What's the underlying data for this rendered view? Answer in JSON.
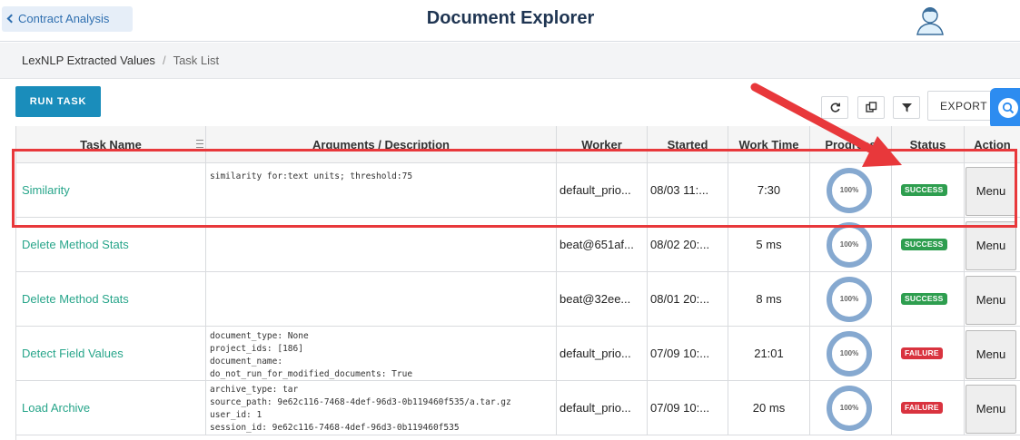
{
  "header": {
    "back_label": "Contract Analysis",
    "title": "Document Explorer"
  },
  "breadcrumb": {
    "parent": "LexNLP Extracted Values",
    "separator": "/",
    "current": "Task List"
  },
  "toolbar": {
    "run_task_label": "RUN TASK",
    "export_label": "EXPORT"
  },
  "table": {
    "columns": [
      "Task Name",
      "Arguments / Description",
      "Worker",
      "Started",
      "Work Time",
      "Progress",
      "Status",
      "Action"
    ],
    "rows": [
      {
        "name": "Similarity",
        "args": "similarity for:text units; threshold:75",
        "worker": "default_prio...",
        "started": "08/03 11:...",
        "work_time": "7:30",
        "progress_label": "100%",
        "progress": 1.0,
        "status": "SUCCESS",
        "action": "Menu"
      },
      {
        "name": "Delete Method Stats",
        "args": "",
        "worker": "beat@651af...",
        "started": "08/02 20:...",
        "work_time": "5 ms",
        "progress_label": "100%",
        "progress": 1.0,
        "status": "SUCCESS",
        "action": "Menu"
      },
      {
        "name": "Delete Method Stats",
        "args": "",
        "worker": "beat@32ee...",
        "started": "08/01 20:...",
        "work_time": "8 ms",
        "progress_label": "100%",
        "progress": 1.0,
        "status": "SUCCESS",
        "action": "Menu"
      },
      {
        "name": "Detect Field Values",
        "args": "document_type: None\nproject_ids: [186]\ndocument_name:\ndo_not_run_for_modified_documents: True",
        "worker": "default_prio...",
        "started": "07/09 10:...",
        "work_time": "21:01",
        "progress_label": "100%",
        "progress": 1.0,
        "status": "FAILURE",
        "action": "Menu"
      },
      {
        "name": "Load Archive",
        "args": "archive_type: tar\nsource_path: 9e62c116-7468-4def-96d3-0b119460f535/a.tar.gz\nuser_id: 1\nsession_id: 9e62c116-7468-4def-96d3-0b119460f535",
        "worker": "default_prio...",
        "started": "07/09 10:...",
        "work_time": "20 ms",
        "progress_label": "100%",
        "progress": 1.0,
        "status": "FAILURE",
        "action": "Menu"
      }
    ]
  },
  "colors": {
    "success": "#2e9e4f",
    "failure": "#d9333f",
    "link": "#27a58a",
    "primary": "#1a8dbb",
    "annotation": "#e8383b"
  },
  "icons": {
    "back": "chevron-left-icon",
    "avatar": "user-avatar-icon",
    "refresh": "refresh-icon",
    "copy": "copy-icon",
    "filter": "filter-icon",
    "search": "search-icon"
  }
}
